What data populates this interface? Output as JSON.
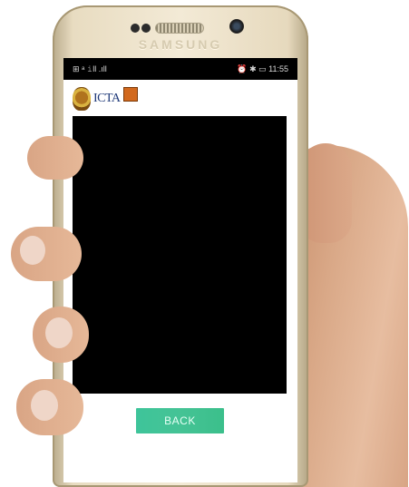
{
  "device": {
    "brand": "SAMSUNG"
  },
  "status_bar": {
    "left_text": "⊞ ᵃ 𝚒ll  .ıll",
    "right_text": "⏰ ✱ ▭ 11:55"
  },
  "app": {
    "logo_text": "ICTA",
    "video_area_color": "#000000",
    "back_button_label": "BACK",
    "accent": "#45c395"
  },
  "icons": [
    "emblem-icon",
    "icta-square-icon",
    "signal-icon",
    "battery-icon",
    "alarm-icon",
    "bluetooth-icon"
  ]
}
